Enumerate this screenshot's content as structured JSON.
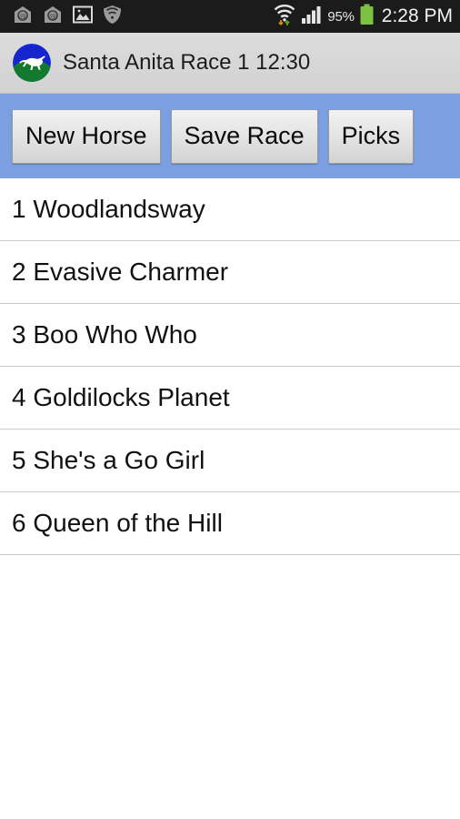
{
  "status_bar": {
    "background_color": "#1b1b1b",
    "notifications": [
      {
        "name": "app-home-icon-1",
        "label": "home-app"
      },
      {
        "name": "app-home-icon-2",
        "label": "home-app"
      },
      {
        "name": "gallery-image-icon",
        "label": "image"
      },
      {
        "name": "shield-wifi-icon",
        "label": "shield"
      }
    ],
    "wifi_icon": "wifi-data-transfer-icon",
    "signal_icon": "cellular-signal-icon",
    "battery_percent": "95%",
    "battery_icon": "battery-icon",
    "battery_color": "#7cc142",
    "clock": "2:28 PM"
  },
  "title_bar": {
    "logo_icon": "running-horse-logo",
    "logo_sky_color": "#1526cf",
    "logo_ground_color": "#127a2e",
    "title": "Santa Anita Race 1 12:30",
    "background_color": "#d6d6d6"
  },
  "button_bar": {
    "background_color": "#7b9fe0",
    "buttons": [
      {
        "label": "New Horse",
        "name": "new-horse-button"
      },
      {
        "label": "Save Race",
        "name": "save-race-button"
      },
      {
        "label": "Picks",
        "name": "picks-button"
      }
    ]
  },
  "horse_list": {
    "rows": [
      {
        "number": "1",
        "name": "Woodlandsway",
        "text": "1 Woodlandsway"
      },
      {
        "number": "2",
        "name": "Evasive Charmer",
        "text": "2 Evasive Charmer"
      },
      {
        "number": "3",
        "name": "Boo Who Who",
        "text": "3 Boo Who Who"
      },
      {
        "number": "4",
        "name": "Goldilocks Planet",
        "text": "4 Goldilocks Planet"
      },
      {
        "number": "5",
        "name": "She's a Go Girl",
        "text": "5 She's a Go Girl"
      },
      {
        "number": "6",
        "name": "Queen of the Hill",
        "text": "6 Queen of the Hill"
      }
    ]
  }
}
